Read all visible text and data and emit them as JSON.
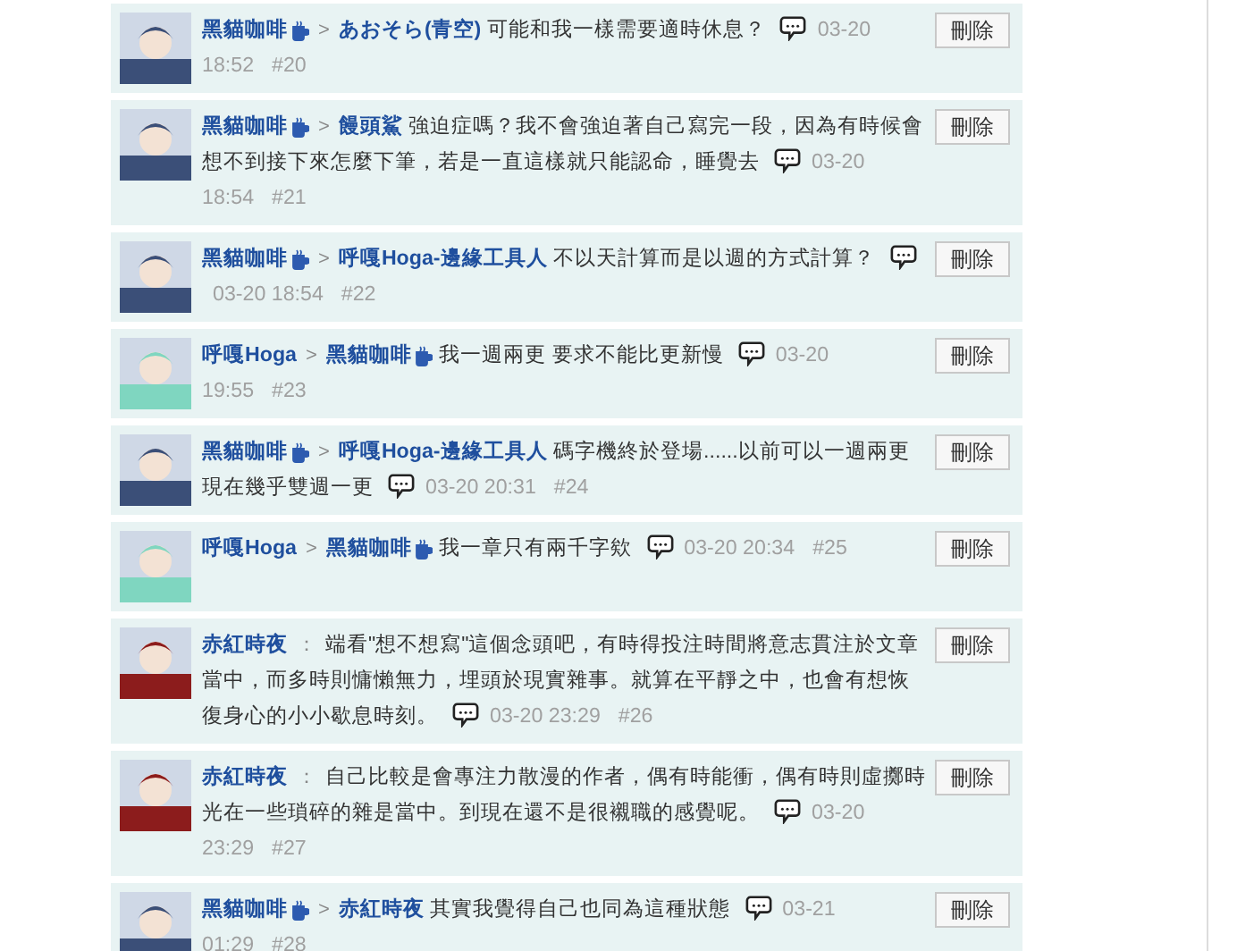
{
  "comments": [
    {
      "author": {
        "name": "黑貓咖啡",
        "badge": true,
        "color": "#3b4f78"
      },
      "sep": ">",
      "target": {
        "name": "あおそら(青空)",
        "badge": false
      },
      "text": "可能和我一樣需要適時休息？",
      "date": "03-20",
      "clock": "18:52",
      "num": "#20",
      "action": "刪除"
    },
    {
      "author": {
        "name": "黑貓咖啡",
        "badge": true,
        "color": "#3b4f78"
      },
      "sep": ">",
      "target": {
        "name": "饅頭鯊",
        "badge": false
      },
      "text": "強迫症嗎？我不會強迫著自己寫完一段，因為有時候會想不到接下來怎麼下筆，若是一直這樣就只能認命，睡覺去",
      "date": "03-20",
      "clock": "18:54",
      "num": "#21",
      "action": "刪除"
    },
    {
      "author": {
        "name": "黑貓咖啡",
        "badge": true,
        "color": "#3b4f78"
      },
      "sep": ">",
      "target": {
        "name": "呼嘎Hoga-邊緣工具人",
        "badge": false
      },
      "text": "不以天計算而是以週的方式計算？",
      "date": "03-20",
      "clock": "18:54",
      "num": "#22",
      "action": "刪除"
    },
    {
      "author": {
        "name": "呼嘎Hoga",
        "badge": false,
        "color": "#7fd6c0"
      },
      "sep": ">",
      "target": {
        "name": "黑貓咖啡",
        "badge": true
      },
      "text": "我一週兩更 要求不能比更新慢",
      "date": "03-20",
      "clock": "19:55",
      "num": "#23",
      "action": "刪除"
    },
    {
      "author": {
        "name": "黑貓咖啡",
        "badge": true,
        "color": "#3b4f78"
      },
      "sep": ">",
      "target": {
        "name": "呼嘎Hoga-邊緣工具人",
        "badge": false
      },
      "text": "碼字機終於登場......以前可以一週兩更現在幾乎雙週一更",
      "date": "03-20",
      "clock": "20:31",
      "num": "#24",
      "action": "刪除"
    },
    {
      "author": {
        "name": "呼嘎Hoga",
        "badge": false,
        "color": "#7fd6c0"
      },
      "sep": ">",
      "target": {
        "name": "黑貓咖啡",
        "badge": true
      },
      "text": "我一章只有兩千字欸",
      "date": "03-20",
      "clock": "20:34",
      "num": "#25",
      "action": "刪除"
    },
    {
      "author": {
        "name": "赤紅時夜",
        "badge": false,
        "color": "#8c1c1c"
      },
      "sep": "：",
      "text": "端看\"想不想寫\"這個念頭吧，有時得投注時間將意志貫注於文章當中，而多時則慵懶無力，埋頭於現實雜事。就算在平靜之中，也會有想恢復身心的小小歇息時刻。",
      "date": "03-20",
      "clock": "23:29",
      "num": "#26",
      "action": "刪除"
    },
    {
      "author": {
        "name": "赤紅時夜",
        "badge": false,
        "color": "#8c1c1c"
      },
      "sep": "：",
      "text": "自己比較是會專注力散漫的作者，偶有時能衝，偶有時則虛擲時光在一些瑣碎的雜是當中。到現在還不是很襯職的感覺呢。",
      "date": "03-20",
      "clock": "23:29",
      "num": "#27",
      "action": "刪除"
    },
    {
      "author": {
        "name": "黑貓咖啡",
        "badge": true,
        "color": "#3b4f78"
      },
      "sep": ">",
      "target": {
        "name": "赤紅時夜",
        "badge": false
      },
      "text": "其實我覺得自己也同為這種狀態",
      "date": "03-21",
      "clock": "01:29",
      "num": "#28",
      "action": "刪除"
    }
  ]
}
